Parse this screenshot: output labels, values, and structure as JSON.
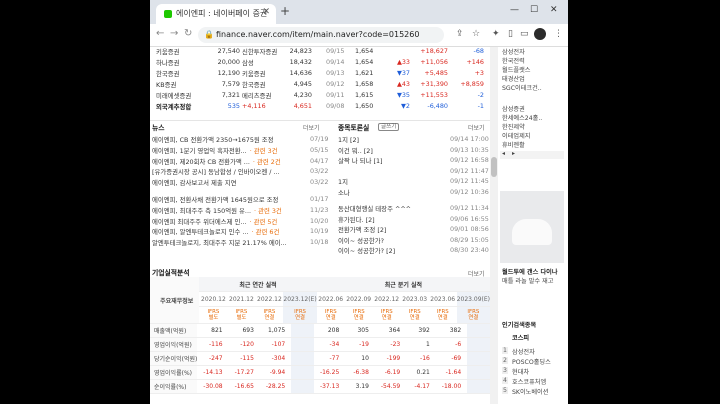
{
  "tab": {
    "title": "에이엔피 : 네이버페이 증권"
  },
  "url": "finance.naver.com/item/main.naver?code=015260",
  "brokers": [
    {
      "name": "키움증권",
      "v1": "27,540",
      "name2": "신한투자증권",
      "v2": "24,823"
    },
    {
      "name": "하나증권",
      "v1": "20,000",
      "name2": "삼성",
      "v2": "18,432"
    },
    {
      "name": "한국증권",
      "v1": "12,190",
      "name2": "키움증권",
      "v2": "14,636"
    },
    {
      "name": "KB증권",
      "v1": "7,579",
      "name2": "한국증권",
      "v2": "4,945"
    },
    {
      "name": "미래에셋증권",
      "v1": "7,321",
      "name2": "메리츠증권",
      "v2": "4,230"
    },
    {
      "name": "외국계추정합",
      "v1": "535",
      "name2": "+4,116",
      "v2": "4,651"
    }
  ],
  "daily": [
    {
      "date": "09/15",
      "price": "1,654",
      "chg": "",
      "chgc": "",
      "vol": "+18,627",
      "f": "-68"
    },
    {
      "date": "09/14",
      "price": "1,654",
      "chg": "▲33",
      "chgc": "red",
      "vol": "+11,056",
      "f": "+146"
    },
    {
      "date": "09/13",
      "price": "1,621",
      "chg": "▼37",
      "chgc": "blue",
      "vol": "+5,485",
      "f": "+3"
    },
    {
      "date": "09/12",
      "price": "1,658",
      "chg": "▲43",
      "chgc": "red",
      "vol": "+31,390",
      "f": "+8,859"
    },
    {
      "date": "09/11",
      "price": "1,615",
      "chg": "▼35",
      "chgc": "blue",
      "vol": "+11,553",
      "f": "-2"
    },
    {
      "date": "09/08",
      "price": "1,650",
      "chg": "▼2",
      "chgc": "blue",
      "vol": "-6,480",
      "f": "-1"
    }
  ],
  "news": {
    "header": "뉴스",
    "more": "더보기",
    "items": [
      {
        "t": "에이엔피, CB 전환가액 2350→1675원 조정",
        "d": "07/19",
        "r": ""
      },
      {
        "t": "에이엔피, 1분기 영업익 흑자전환...",
        "d": "05/15",
        "r": "관련 3건"
      },
      {
        "t": "에이엔피, 제20회차 CB 전환가액 ...",
        "d": "04/17",
        "r": "관련 2건"
      },
      {
        "t": "[유가증권시장 공시] 동남합성 / 인바이오젠 / ...",
        "d": "03/22",
        "r": ""
      },
      {
        "t": "에이엔피, 감사보고서 제출 지연",
        "d": "03/22",
        "r": ""
      },
      {
        "t": "에이엔피, 전환사채 전환가액 1645원으로 조정",
        "d": "01/17",
        "r": ""
      },
      {
        "t": "에이엔피, 최대주주 측 150억원 유...",
        "d": "11/23",
        "r": "관련 3건"
      },
      {
        "t": "에이엔피 최대주주 위더에스제 인...",
        "d": "10/20",
        "r": "관련 5건"
      },
      {
        "t": "에이엔피, 알엔투테크놀로지 인수 ...",
        "d": "10/19",
        "r": "관련 6건"
      },
      {
        "t": "알엔투테크놀로지, 최대주주 지분 21.17% 에이...",
        "d": "10/18",
        "r": ""
      }
    ]
  },
  "board": {
    "header": "종목토론실",
    "write": "글쓰기",
    "more": "더보기",
    "items": [
      {
        "t": "1지 [2]",
        "d": "09/14 17:00"
      },
      {
        "t": "이건 뭐.. [2]",
        "d": "09/13 10:35"
      },
      {
        "t": "살짝 나 되나 [1]",
        "d": "09/12 16:58"
      },
      {
        "t": "",
        "d": "09/12 11:47"
      },
      {
        "t": "1지",
        "d": "09/12 11:45"
      },
      {
        "t": "소나",
        "d": "09/12 10:36"
      },
      {
        "t": "동산대형행실 테장주 ^^^",
        "d": "09/12 11:34"
      },
      {
        "t": "휴가된다. [2]",
        "d": "09/06 16:55"
      },
      {
        "t": "전환가액 조정 [2]",
        "d": "09/01 08:56"
      },
      {
        "t": "이이~ 성공한가?",
        "d": "08/29 15:05"
      },
      {
        "t": "이이~ 성공한가? [2]",
        "d": "08/30 23:40"
      }
    ]
  },
  "fin": {
    "header": "기업실적분석",
    "more": "더보기",
    "label_col": "주요재무정보",
    "annual_label": "최근 연간 실적",
    "quarter_label": "최근 분기 실적",
    "years": [
      "2020.12",
      "2021.12",
      "2022.12",
      "2023.12(E)",
      "2022.06",
      "2022.09",
      "2022.12",
      "2023.03",
      "2023.06",
      "2023.09(E)"
    ],
    "ifrs": [
      "IFRS 별도",
      "IFRS 별도",
      "IFRS 연결",
      "IFRS 연결",
      "IFRS 연결",
      "IFRS 연결",
      "IFRS 연결",
      "IFRS 연결",
      "IFRS 연결",
      "IFRS 연결"
    ],
    "rows": [
      {
        "name": "매출액(억원)",
        "vals": [
          "821",
          "693",
          "1,075",
          "",
          "208",
          "305",
          "364",
          "392",
          "382",
          ""
        ]
      },
      {
        "name": "영업이익(억원)",
        "vals": [
          "-116",
          "-120",
          "-107",
          "",
          "-34",
          "-19",
          "-23",
          "1",
          "-6",
          ""
        ]
      },
      {
        "name": "당기순이익(억원)",
        "vals": [
          "-247",
          "-115",
          "-304",
          "",
          "-77",
          "10",
          "-199",
          "-16",
          "-69",
          ""
        ]
      },
      {
        "name": "영업이익률(%)",
        "vals": [
          "-14.13",
          "-17.27",
          "-9.94",
          "",
          "-16.25",
          "-6.38",
          "-6.19",
          "0.21",
          "-1.64",
          ""
        ]
      },
      {
        "name": "순이익률(%)",
        "vals": [
          "-30.08",
          "-16.65",
          "-28.25",
          "",
          "-37.13",
          "3.19",
          "-54.59",
          "-4.17",
          "-18.00",
          ""
        ]
      }
    ]
  },
  "side": {
    "list1": [
      "삼성전자",
      "한국전력",
      "월드플랫스",
      "태경산업",
      "SGC이테크건.."
    ],
    "list2": [
      "삼성증권",
      "한세예스24홀..",
      "한진제약",
      "이테업제지",
      "휴비젠활"
    ],
    "ad_caption": "월드투에 갠스 다이나",
    "ad_sub": "매틀 라놀 말수 재고",
    "rank_header": "인기검색종목",
    "rank_tab": "코스피",
    "ranks": [
      {
        "n": "1",
        "t": "삼성전자"
      },
      {
        "n": "2",
        "t": "POSCO홀딩스"
      },
      {
        "n": "3",
        "t": "현대차"
      },
      {
        "n": "4",
        "t": "호스코퓨처엠"
      },
      {
        "n": "5",
        "t": "SK이노베이션"
      }
    ]
  }
}
